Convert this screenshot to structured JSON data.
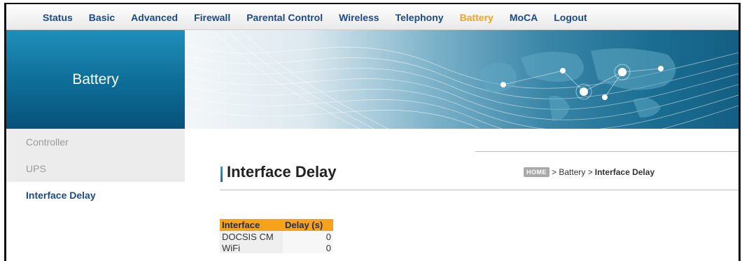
{
  "nav": {
    "items": [
      {
        "label": "Status"
      },
      {
        "label": "Basic"
      },
      {
        "label": "Advanced"
      },
      {
        "label": "Firewall"
      },
      {
        "label": "Parental Control"
      },
      {
        "label": "Wireless"
      },
      {
        "label": "Telephony"
      },
      {
        "label": "Battery",
        "active": true
      },
      {
        "label": "MoCA"
      },
      {
        "label": "Logout"
      }
    ],
    "active_color": "#f7a21b",
    "link_color": "#1a4a8c"
  },
  "banner": {
    "section_title": "Battery"
  },
  "sidebar": {
    "items": [
      {
        "label": "Controller"
      },
      {
        "label": "UPS"
      },
      {
        "label": "Interface Delay",
        "active": true
      }
    ]
  },
  "main": {
    "title": "Interface Delay",
    "breadcrumb": {
      "home": "HOME",
      "sep1": ">",
      "section": "Battery",
      "sep2": ">",
      "current": "Interface Delay"
    },
    "table": {
      "headers": [
        "Interface",
        "Delay (s)"
      ],
      "rows": [
        {
          "interface": "DOCSIS CM",
          "delay": "0"
        },
        {
          "interface": "WiFi",
          "delay": "0"
        }
      ],
      "header_color": "#f7a21b"
    }
  }
}
